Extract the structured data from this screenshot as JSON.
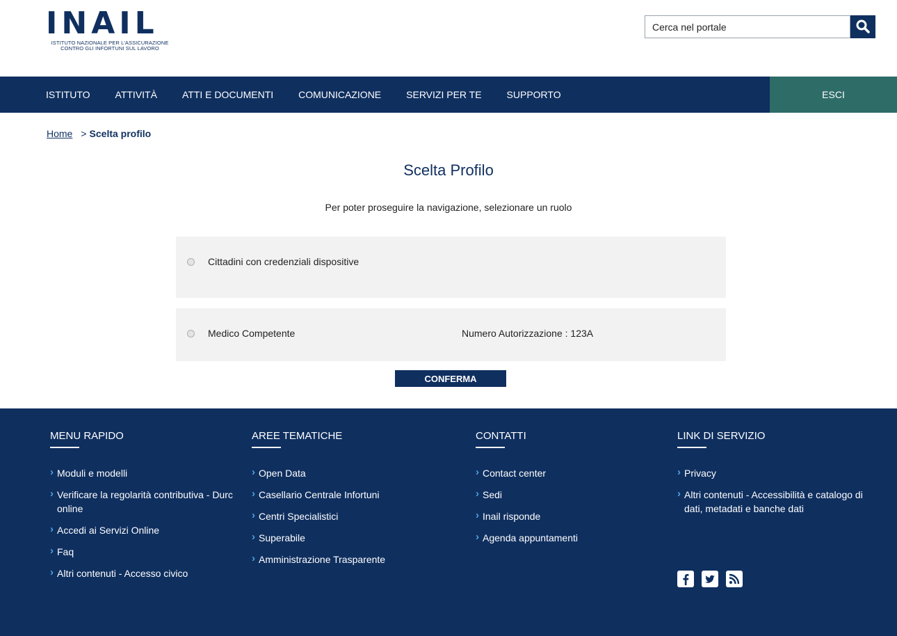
{
  "header": {
    "logo_word": "INAIL",
    "logo_sub_1": "ISTITUTO NAZIONALE PER L'ASSICURAZIONE",
    "logo_sub_2": "CONTRO GLI INFORTUNI SUL LAVORO",
    "search_placeholder": "Cerca nel portale",
    "search_icon": "search-icon"
  },
  "nav": {
    "items": [
      "Istituto",
      "Attività",
      "Atti e documenti",
      "Comunicazione",
      "Servizi per te",
      "Supporto"
    ],
    "exit_label": "ESCI"
  },
  "breadcrumb": {
    "home": "Home",
    "separator": ">",
    "current": "Scelta profilo"
  },
  "main": {
    "title": "Scelta Profilo",
    "subtitle": "Per poter proseguire la navigazione, selezionare un ruolo",
    "roles": [
      {
        "label": "Cittadini con credenziali dispositive",
        "selected": false
      },
      {
        "label": "Medico Competente",
        "extra": "Numero Autorizzazione : 123A",
        "selected": false
      }
    ],
    "confirm_label": "CONFERMA"
  },
  "footer": {
    "columns": [
      {
        "title": "Menu rapido",
        "items": [
          "Moduli e modelli",
          "Verificare la regolarità contributiva - Durc online",
          "Accedi ai Servizi Online",
          "Faq",
          "Altri contenuti - Accesso civico"
        ]
      },
      {
        "title": "Aree tematiche",
        "items": [
          "Open Data",
          "Casellario Centrale Infortuni",
          "Centri Specialistici",
          "Superabile",
          "Amministrazione Trasparente"
        ]
      },
      {
        "title": "Contatti",
        "items": [
          "Contact center",
          "Sedi",
          "Inail risponde",
          "Agenda appuntamenti"
        ]
      },
      {
        "title": "Link di servizio",
        "items": [
          "Privacy",
          "Altri contenuti - Accessibilità e catalogo di dati, metadati e banche dati"
        ]
      }
    ],
    "social_icons": [
      "facebook-icon",
      "twitter-icon",
      "rss-icon"
    ]
  },
  "colors": {
    "primary": "#0f2f5f",
    "exit": "#2e6c68",
    "card_bg": "#f2f2f2",
    "footer_bullet": "#4fa3e0"
  }
}
